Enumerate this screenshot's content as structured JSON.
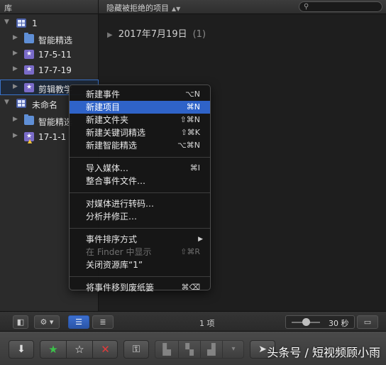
{
  "header": {
    "library_title": "库",
    "filter_label": "隐藏被拒绝的项目",
    "filter_icon": "updown-arrows-icon",
    "search_placeholder": ""
  },
  "sidebar": {
    "library1": {
      "name": "1",
      "items": [
        {
          "label": "智能精选",
          "icon": "folder-icon"
        },
        {
          "label": "17-5-11",
          "icon": "star-event-icon"
        },
        {
          "label": "17-7-19",
          "icon": "star-event-icon"
        },
        {
          "label": "剪辑教学",
          "icon": "star-event-icon",
          "selected": true
        }
      ]
    },
    "library2": {
      "name": "未命名",
      "items": [
        {
          "label": "智能精选",
          "icon": "folder-icon"
        },
        {
          "label": "17-1-1",
          "icon": "star-event-warning-icon"
        }
      ]
    }
  },
  "browser": {
    "date_group": "2017年7月19日",
    "date_count": "(1)"
  },
  "context_menu": {
    "group1": [
      {
        "label": "新建事件",
        "shortcut": "⌥N"
      },
      {
        "label": "新建项目",
        "shortcut": "⌘N",
        "highlighted": true
      },
      {
        "label": "新建文件夹",
        "shortcut": "⇧⌘N"
      },
      {
        "label": "新建关键词精选",
        "shortcut": "⇧⌘K"
      },
      {
        "label": "新建智能精选",
        "shortcut": "⌥⌘N"
      }
    ],
    "group2": [
      {
        "label": "导入媒体…",
        "shortcut": "⌘I"
      },
      {
        "label": "整合事件文件…",
        "shortcut": ""
      }
    ],
    "group3": [
      {
        "label": "对媒体进行转码…",
        "shortcut": ""
      },
      {
        "label": "分析并修正…",
        "shortcut": ""
      }
    ],
    "group4": [
      {
        "label": "事件排序方式",
        "shortcut": "",
        "submenu": true
      },
      {
        "label": "在 Finder 中显示",
        "shortcut": "⇧⌘R",
        "disabled": true
      },
      {
        "label": "关闭资源库“1”",
        "shortcut": ""
      }
    ],
    "group5": [
      {
        "label": "将事件移到废纸篓",
        "shortcut": "⌘⌫"
      }
    ]
  },
  "browser_toolbar": {
    "clip_count": "1 项",
    "duration": "30 秒"
  },
  "app_toolbar": {
    "watermark": "头条号 / 短视频顾小雨"
  }
}
